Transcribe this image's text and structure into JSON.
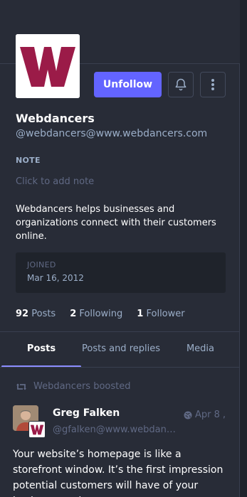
{
  "profile": {
    "display_name": "Webdancers",
    "handle": "@webdancers@www.webdancers.com",
    "avatar_letter": "W",
    "brand_color": "#9b1b48"
  },
  "actions": {
    "unfollow_label": "Unfollow",
    "bell_icon": "bell-icon",
    "more_icon": "more-vertical-icon"
  },
  "note": {
    "label": "NOTE",
    "placeholder": "Click to add note"
  },
  "bio": "Webdancers helps businesses and organizations connect with their customers online.",
  "joined": {
    "label": "JOINED",
    "date": "Mar 16, 2012"
  },
  "stats": {
    "posts_count": "92",
    "posts_label": "Posts",
    "following_count": "2",
    "following_label": "Following",
    "followers_count": "1",
    "followers_label": "Follower"
  },
  "tabs": [
    {
      "label": "Posts",
      "active": true
    },
    {
      "label": "Posts and replies",
      "active": false
    },
    {
      "label": "Media",
      "active": false
    }
  ],
  "post": {
    "boosted_by": "Webdancers boosted",
    "author": "Greg Falken",
    "author_handle": "@gfalken@www.webdancers.com",
    "date": "Apr 8",
    "date_suffix": ",",
    "visibility_icon": "globe-icon",
    "body": "Your website’s homepage is like a storefront window. It’s the first impression potential customers will have of your business, and"
  },
  "colors": {
    "background": "#282c37",
    "accent": "#6364ff",
    "muted": "#9baec8",
    "dim": "#606984"
  }
}
